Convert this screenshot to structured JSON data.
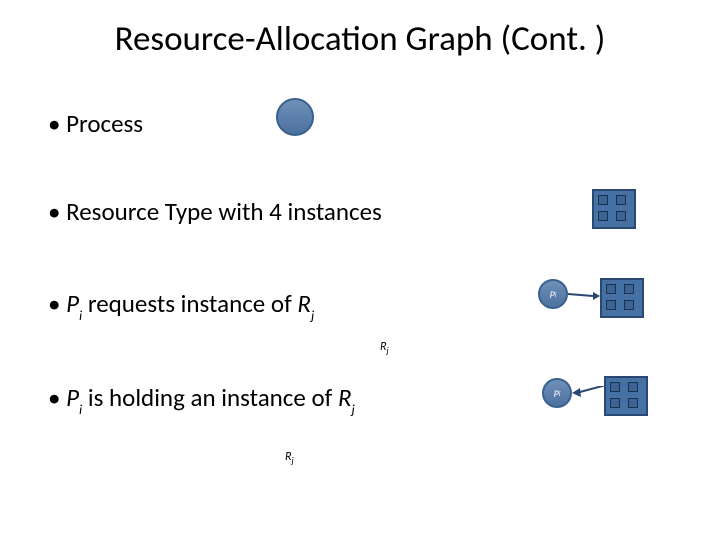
{
  "title": "Resource-Allocation Graph (Cont. )",
  "bullets": {
    "process": "Process",
    "resource_type": "Resource Type with 4 instances",
    "requests_prefix": "P",
    "requests_sub1": "i",
    "requests_mid": " requests instance of ",
    "requests_r": "R",
    "requests_sub2": "j",
    "holding_prefix": "P",
    "holding_sub1": "i",
    "holding_mid": " is holding an instance of ",
    "holding_r": "R",
    "holding_sub2": "j"
  },
  "labels": {
    "pi_p": "P",
    "pi_i": "i",
    "rj_r": "R",
    "rj_j": "j"
  }
}
